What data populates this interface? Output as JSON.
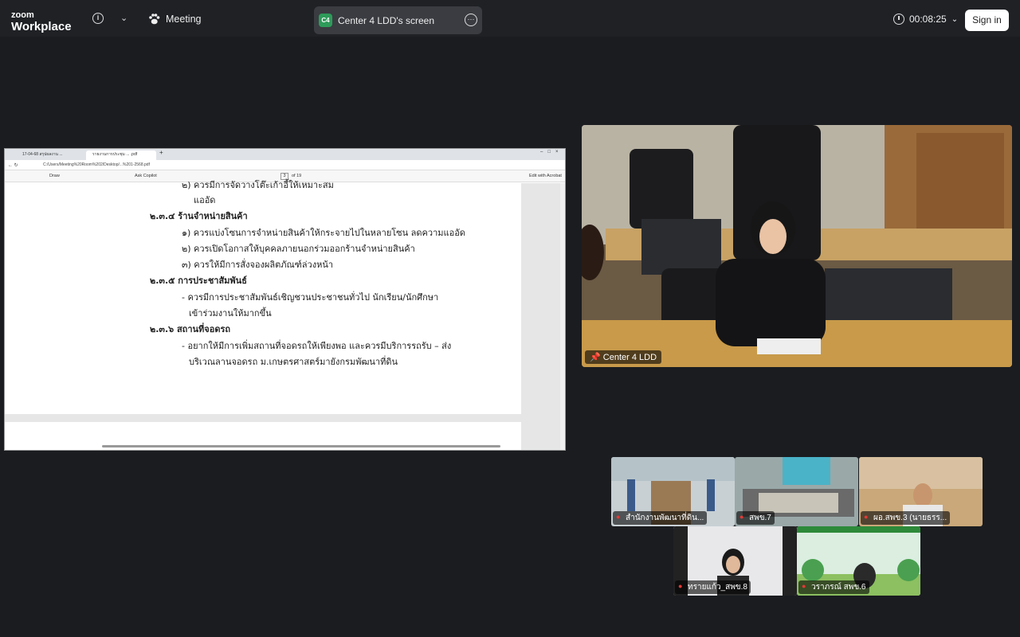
{
  "topbar": {
    "logo_small": "zoom",
    "logo_big": "Workplace",
    "meeting_label": "Meeting",
    "screen_badge": "C4",
    "screen_label": "Center 4 LDD's screen",
    "timer": "00:08:25",
    "sign_in": "Sign in"
  },
  "shared_screen": {
    "tabs": [
      "17-04-68 สรุปผลงาน ...",
      "รายงานการประชุม ... .pdf"
    ],
    "address": "C:/Users/Meeting%20Room%202/Desktop/...%201-2568.pdf",
    "toolbar": {
      "draw": "Draw",
      "ask_copilot": "Ask Copilot",
      "page_current": "3",
      "page_total": "of 19",
      "edit_acrobat": "Edit with Acrobat"
    },
    "doc_lines": [
      "๒) ควรมีการจัดวางโต๊ะเก้าอี้ให้เหมาะสม",
      "แออัด",
      "๒.๓.๔ ร้านจำหน่ายสินค้า",
      "๑) ควรแบ่งโซนการจำหน่ายสินค้าให้กระจายไปในหลายโซน ลดความแออัด",
      "๒) ควรเปิดโอกาสให้บุคคลภายนอกร่วมออกร้านจำหน่ายสินค้า",
      "๓) ควรให้มีการสั่งจองผลิตภัณฑ์ล่วงหน้า",
      "๒.๓.๕ การประชาสัมพันธ์",
      "- ควรมีการประชาสัมพันธ์เชิญชวนประชาชนทั่วไป นักเรียน/นักศึกษา",
      "เข้าร่วมงานให้มากขึ้น",
      "๒.๓.๖ สถานที่จอดรถ",
      "- อยากให้มีการเพิ่มสถานที่จอดรถให้เพียงพอ และควรมีบริการรถรับ – ส่ง",
      "บริเวณลานจอดรถ  ม.เกษตรศาสตร์มายังกรมพัฒนาที่ดิน"
    ]
  },
  "main_video": {
    "name": "Center 4 LDD"
  },
  "participants": [
    {
      "name": "สำนักงานพัฒนาที่ดิน..."
    },
    {
      "name": "สพข.7"
    },
    {
      "name": "ผอ.สพข.3 (นายธรร..."
    },
    {
      "name": "ทรายแก้ว_สพข.8"
    },
    {
      "name": "วราภรณ์ สพข.6"
    }
  ]
}
